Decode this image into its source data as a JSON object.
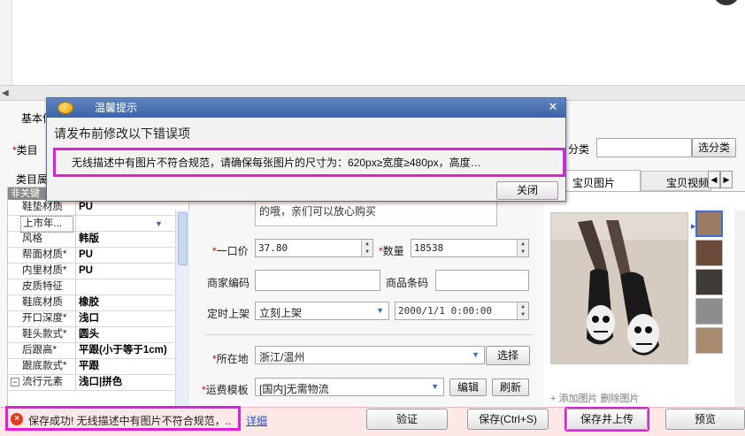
{
  "dialog": {
    "title": "温馨提示",
    "message": "请发布前修改以下错误项",
    "error": "无线描述中有图片不符合规范，请确保每张图片的尺寸为：620px≥宽度≥480px，高度…",
    "close_label": "关闭"
  },
  "left": {
    "tab_basic": "基本信",
    "category_label": "类目",
    "category_tree_label": "类目属",
    "table_header": "非关键",
    "rows": [
      {
        "key": "鞋垫材质",
        "value": "PU"
      },
      {
        "key": "上市年...",
        "value": ""
      },
      {
        "key": "风格",
        "value": "韩版"
      },
      {
        "key": "帮面材质*",
        "value": "PU"
      },
      {
        "key": "内里材质*",
        "value": "PU"
      },
      {
        "key": "皮质特征",
        "value": ""
      },
      {
        "key": "鞋底材质",
        "value": "橡胶"
      },
      {
        "key": "开口深度*",
        "value": "浅口"
      },
      {
        "key": "鞋头款式*",
        "value": "圆头"
      },
      {
        "key": "后跟高*",
        "value": "平跟(小于等于1cm)"
      },
      {
        "key": "跟底款式*",
        "value": "平跟"
      },
      {
        "key": "流行元素",
        "value": "浅口|拼色"
      }
    ]
  },
  "form": {
    "desc_text": "的哦，亲们可以放心购买",
    "price_label": "一口价",
    "price_value": "37.80",
    "qty_label": "数量",
    "qty_value": "18538",
    "merchant_code_label": "商家编码",
    "merchant_code_value": "",
    "barcode_label": "商品条码",
    "barcode_value": "",
    "schedule_label": "定时上架",
    "schedule_value": "立刻上架",
    "schedule_time": "2000/1/1 0:00:00",
    "location_label": "所在地",
    "location_value": "浙江/温州",
    "location_btn": "选择",
    "shipping_label": "运费模板",
    "shipping_value": "[国内]无需物流",
    "edit_btn": "编辑",
    "refresh_btn": "刷新"
  },
  "right": {
    "class_label": "分类",
    "class_btn": "选分类",
    "tab_images": "宝贝图片",
    "tab_video": "宝贝视频",
    "img_links": "+ 添加图片      删除图片"
  },
  "status": {
    "text": "保存成功! 无线描述中有图片不符合规范，..",
    "link": "详细",
    "btn_verify": "验证",
    "btn_save": "保存(Ctrl+S)",
    "btn_save_upload": "保存并上传",
    "btn_preview": "预览"
  },
  "colors": {
    "highlight": "#e020d8",
    "title_bar": "#3e63a3",
    "status_bg": "#fde7e7",
    "error_icon": "#e23a1a",
    "link": "#2255cc"
  }
}
